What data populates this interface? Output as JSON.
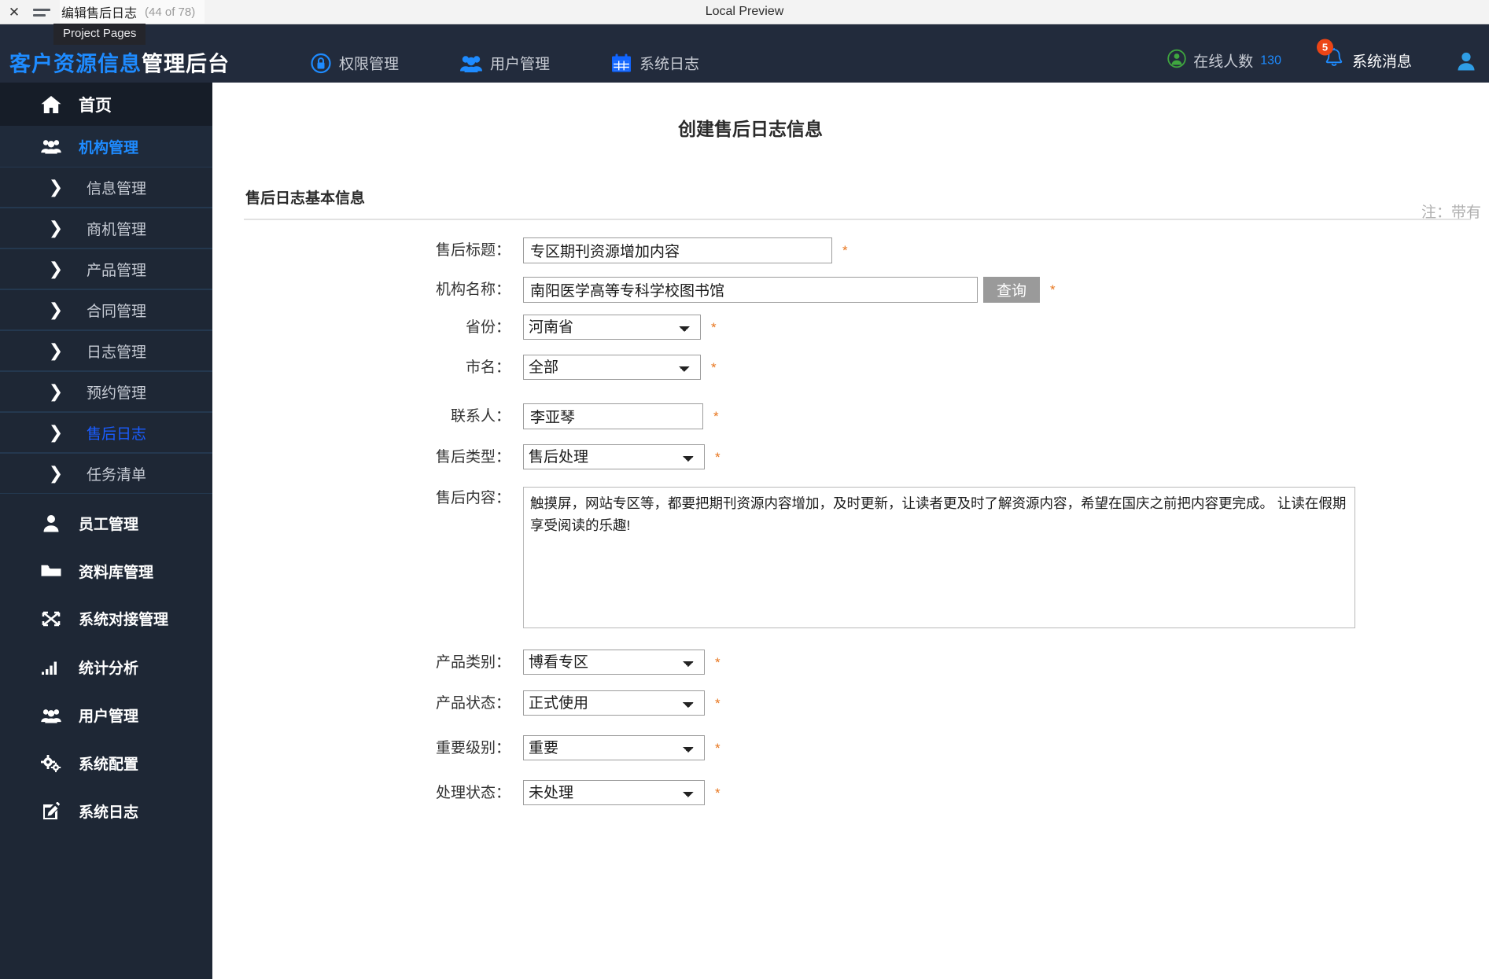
{
  "chrome": {
    "close_icon": "close-icon",
    "menu_icon": "hamburger-icon",
    "tab_title": "编辑售后日志",
    "tab_count": "(44 of 78)",
    "center_title": "Local Preview",
    "tooltip": "Project Pages"
  },
  "topbar": {
    "logo_blue": "客户资源信息",
    "logo_white": "管理后台",
    "nav": [
      {
        "label": "权限管理",
        "icon": "lock-icon"
      },
      {
        "label": "用户管理",
        "icon": "users-icon"
      },
      {
        "label": "系统日志",
        "icon": "calendar-icon"
      }
    ],
    "online_label": "在线人数",
    "online_count": "130",
    "message_label": "系统消息",
    "message_badge": "5",
    "avatar_icon": "user-avatar-icon",
    "accent_blue": "#1e8bff",
    "badge_red": "#ec4516"
  },
  "sidebar": {
    "home": {
      "label": "首页",
      "icon": "home-icon"
    },
    "items": [
      {
        "label": "机构管理",
        "icon": "users-icon",
        "type": "main",
        "active": true
      },
      {
        "label": "信息管理",
        "icon": "chevron-right-icon",
        "type": "sub",
        "active": false
      },
      {
        "label": "商机管理",
        "icon": "chevron-right-icon",
        "type": "sub",
        "active": false
      },
      {
        "label": "产品管理",
        "icon": "chevron-right-icon",
        "type": "sub",
        "active": false
      },
      {
        "label": "合同管理",
        "icon": "chevron-right-icon",
        "type": "sub",
        "active": false
      },
      {
        "label": "日志管理",
        "icon": "chevron-right-icon",
        "type": "sub",
        "active": false
      },
      {
        "label": "预约管理",
        "icon": "chevron-right-icon",
        "type": "sub",
        "active": false
      },
      {
        "label": "售后日志",
        "icon": "chevron-right-icon",
        "type": "sub",
        "active": true
      },
      {
        "label": "任务清单",
        "icon": "chevron-right-icon",
        "type": "sub",
        "active": false
      },
      {
        "label": "员工管理",
        "icon": "user-icon",
        "type": "main",
        "active": false
      },
      {
        "label": "资料库管理",
        "icon": "folder-icon",
        "type": "main",
        "active": false
      },
      {
        "label": "系统对接管理",
        "icon": "exchange-icon",
        "type": "main",
        "active": false
      },
      {
        "label": "统计分析",
        "icon": "bar-chart-icon",
        "type": "main",
        "active": false
      },
      {
        "label": "用户管理",
        "icon": "users-icon",
        "type": "main",
        "active": false
      },
      {
        "label": "系统配置",
        "icon": "cogs-icon",
        "type": "main",
        "active": false
      },
      {
        "label": "系统日志",
        "icon": "edit-icon",
        "type": "main",
        "active": false
      }
    ]
  },
  "main": {
    "page_title": "创建售后日志信息",
    "section_title": "售后日志基本信息",
    "note": "注：带有",
    "required_mark": "*",
    "query_button": "查询",
    "fields": {
      "title": {
        "label": "售后标题：",
        "value": "专区期刊资源增加内容"
      },
      "org": {
        "label": "机构名称：",
        "value": "南阳医学高等专科学校图书馆"
      },
      "province": {
        "label": "省份：",
        "value": "河南省"
      },
      "city": {
        "label": "市名：",
        "value": "全部"
      },
      "contact": {
        "label": "联系人：",
        "value": "李亚琴"
      },
      "type": {
        "label": "售后类型：",
        "value": "售后处理"
      },
      "content": {
        "label": "售后内容：",
        "value": "触摸屏，网站专区等，都要把期刊资源内容增加，及时更新，让读者更及时了解资源内容，希望在国庆之前把内容更完成。 让读在假期享受阅读的乐趣!"
      },
      "product_category": {
        "label": "产品类别：",
        "value": "博看专区"
      },
      "product_status": {
        "label": "产品状态：",
        "value": "正式使用"
      },
      "priority": {
        "label": "重要级别：",
        "value": "重要"
      },
      "handle_status": {
        "label": "处理状态：",
        "value": "未处理"
      }
    }
  }
}
